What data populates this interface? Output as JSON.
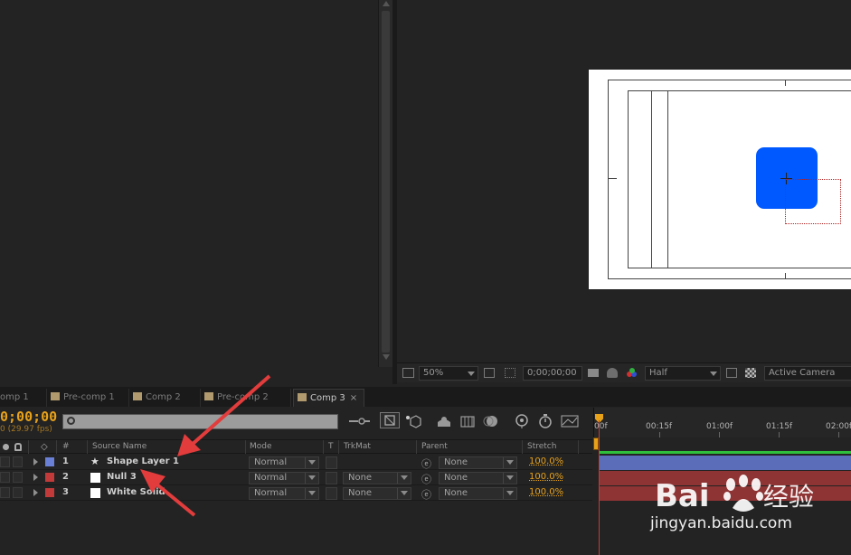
{
  "viewer_toolbar": {
    "zoom": "50%",
    "timecode": "0;00;00;00",
    "resolution": "Half",
    "camera": "Active Camera"
  },
  "tabs": [
    {
      "label": "omp 1",
      "active": false
    },
    {
      "label": "Pre-comp 1",
      "active": false
    },
    {
      "label": "Comp 2",
      "active": false
    },
    {
      "label": "Pre-comp 2",
      "active": false
    },
    {
      "label": "Comp 3",
      "active": true
    }
  ],
  "timeline": {
    "timecode": "0;00;00",
    "fps": "0 (29.97 fps)",
    "ruler": [
      "00f",
      "00:15f",
      "01:00f",
      "01:15f",
      "02:00f"
    ]
  },
  "columns": {
    "num": "#",
    "source_name": "Source Name",
    "mode": "Mode",
    "t": "T",
    "trkmat": "TrkMat",
    "parent": "Parent",
    "stretch": "Stretch"
  },
  "layers": [
    {
      "num": "1",
      "name": "Shape Layer 1",
      "label_color": "#6a7fd6",
      "icon": "star-icon",
      "mode": "Normal",
      "trkmat": "",
      "parent": "None",
      "stretch": "100.0%",
      "bar_color": "#5b6db8"
    },
    {
      "num": "2",
      "name": "Null 3",
      "label_color": "#c23a3a",
      "icon": "null-icon",
      "mode": "Normal",
      "trkmat": "None",
      "parent": "None",
      "stretch": "100.0%",
      "bar_color": "#8e3434"
    },
    {
      "num": "3",
      "name": "White Solid",
      "label_color": "#c23a3a",
      "icon": "solid-icon",
      "mode": "Normal",
      "trkmat": "None",
      "parent": "None",
      "stretch": "100.0%",
      "bar_color": "#8e3434"
    }
  ],
  "watermark": {
    "text": "jingyan.baidu.com",
    "logo_text": "Bai 经验"
  },
  "colors": {
    "accent_orange": "#e8a21a",
    "shape_blue": "#0059ff",
    "panel_bg": "#232323"
  }
}
